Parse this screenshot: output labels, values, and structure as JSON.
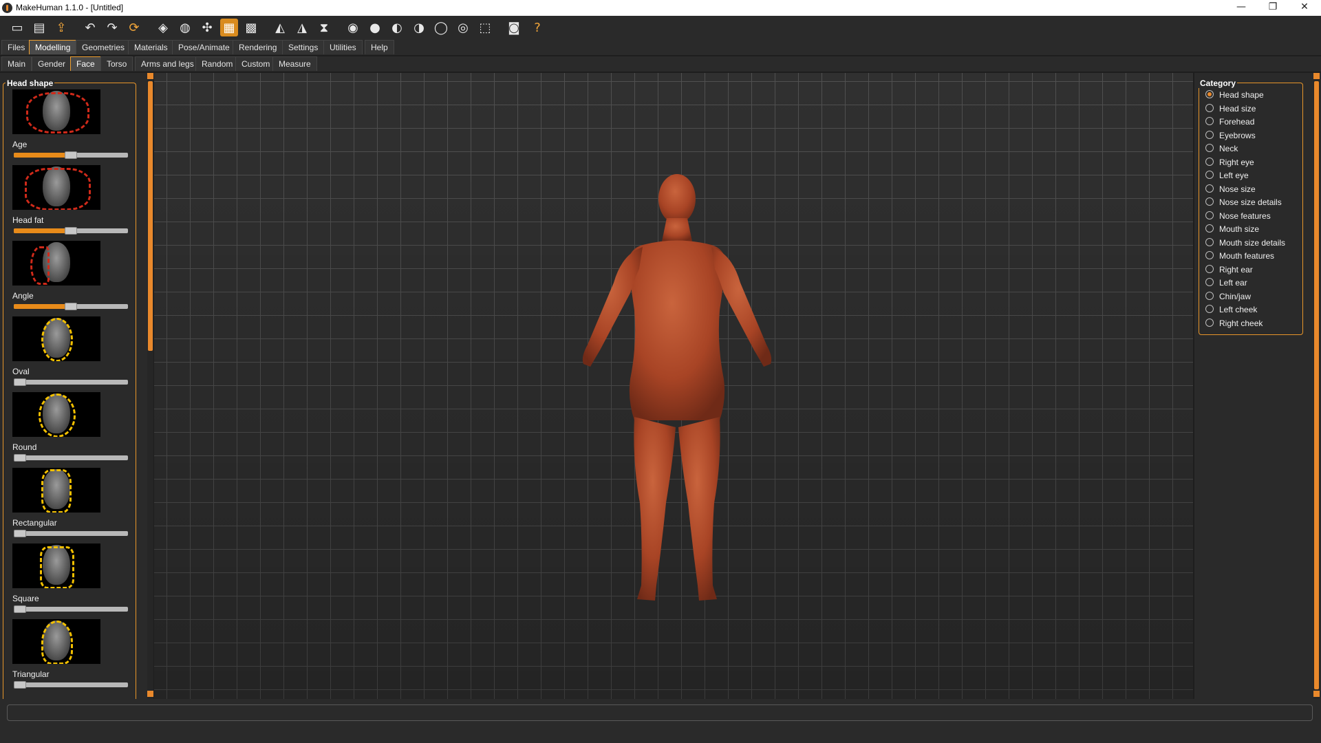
{
  "window": {
    "title": "MakeHuman 1.1.0 - [Untitled]",
    "controls": {
      "minimize": "—",
      "restore": "❐",
      "close": "✕"
    }
  },
  "toolbar": {
    "icons": [
      "new-file-icon",
      "save-icon",
      "export-icon",
      "undo-icon",
      "redo-icon",
      "reset-icon",
      "smooth-icon",
      "wireframe-icon",
      "pose-icon",
      "grid-icon",
      "checker-icon",
      "symmetry-right-icon",
      "symmetry-left-icon",
      "symmetry-icon",
      "front-view-icon",
      "back-view-icon",
      "left-view-icon",
      "right-view-icon",
      "top-view-icon",
      "bottom-view-icon",
      "reset-camera-icon",
      "screenshot-icon",
      "help-icon"
    ],
    "active_icon": "grid-icon"
  },
  "main_tabs": [
    "Files",
    "Modelling",
    "Geometries",
    "Materials",
    "Pose/Animate",
    "Rendering",
    "Settings",
    "Utilities",
    "Help"
  ],
  "main_tab_active": "Modelling",
  "sub_tabs": [
    "Main",
    "Gender",
    "Face",
    "Torso",
    "Arms and legs",
    "Random",
    "Custom",
    "Measure"
  ],
  "sub_tab_active": "Face",
  "left_panel": {
    "title": "Head shape",
    "sliders": [
      {
        "label": "Age",
        "value": 0.5
      },
      {
        "label": "Head fat",
        "value": 0.5
      },
      {
        "label": "Angle",
        "value": 0.5
      },
      {
        "label": "Oval",
        "value": 0.0
      },
      {
        "label": "Round",
        "value": 0.0
      },
      {
        "label": "Rectangular",
        "value": 0.0
      },
      {
        "label": "Square",
        "value": 0.0
      },
      {
        "label": "Triangular",
        "value": 0.0
      }
    ]
  },
  "category": {
    "title": "Category",
    "selected": "Head shape",
    "items": [
      "Head shape",
      "Head size",
      "Forehead",
      "Eyebrows",
      "Neck",
      "Right eye",
      "Left eye",
      "Nose size",
      "Nose size details",
      "Nose features",
      "Mouth size",
      "Mouth size details",
      "Mouth features",
      "Right ear",
      "Left ear",
      "Chin/jaw",
      "Left cheek",
      "Right cheek"
    ]
  },
  "colors": {
    "accent": "#e9892c",
    "skin": "#b04a2a"
  },
  "status": {
    "text": ""
  }
}
